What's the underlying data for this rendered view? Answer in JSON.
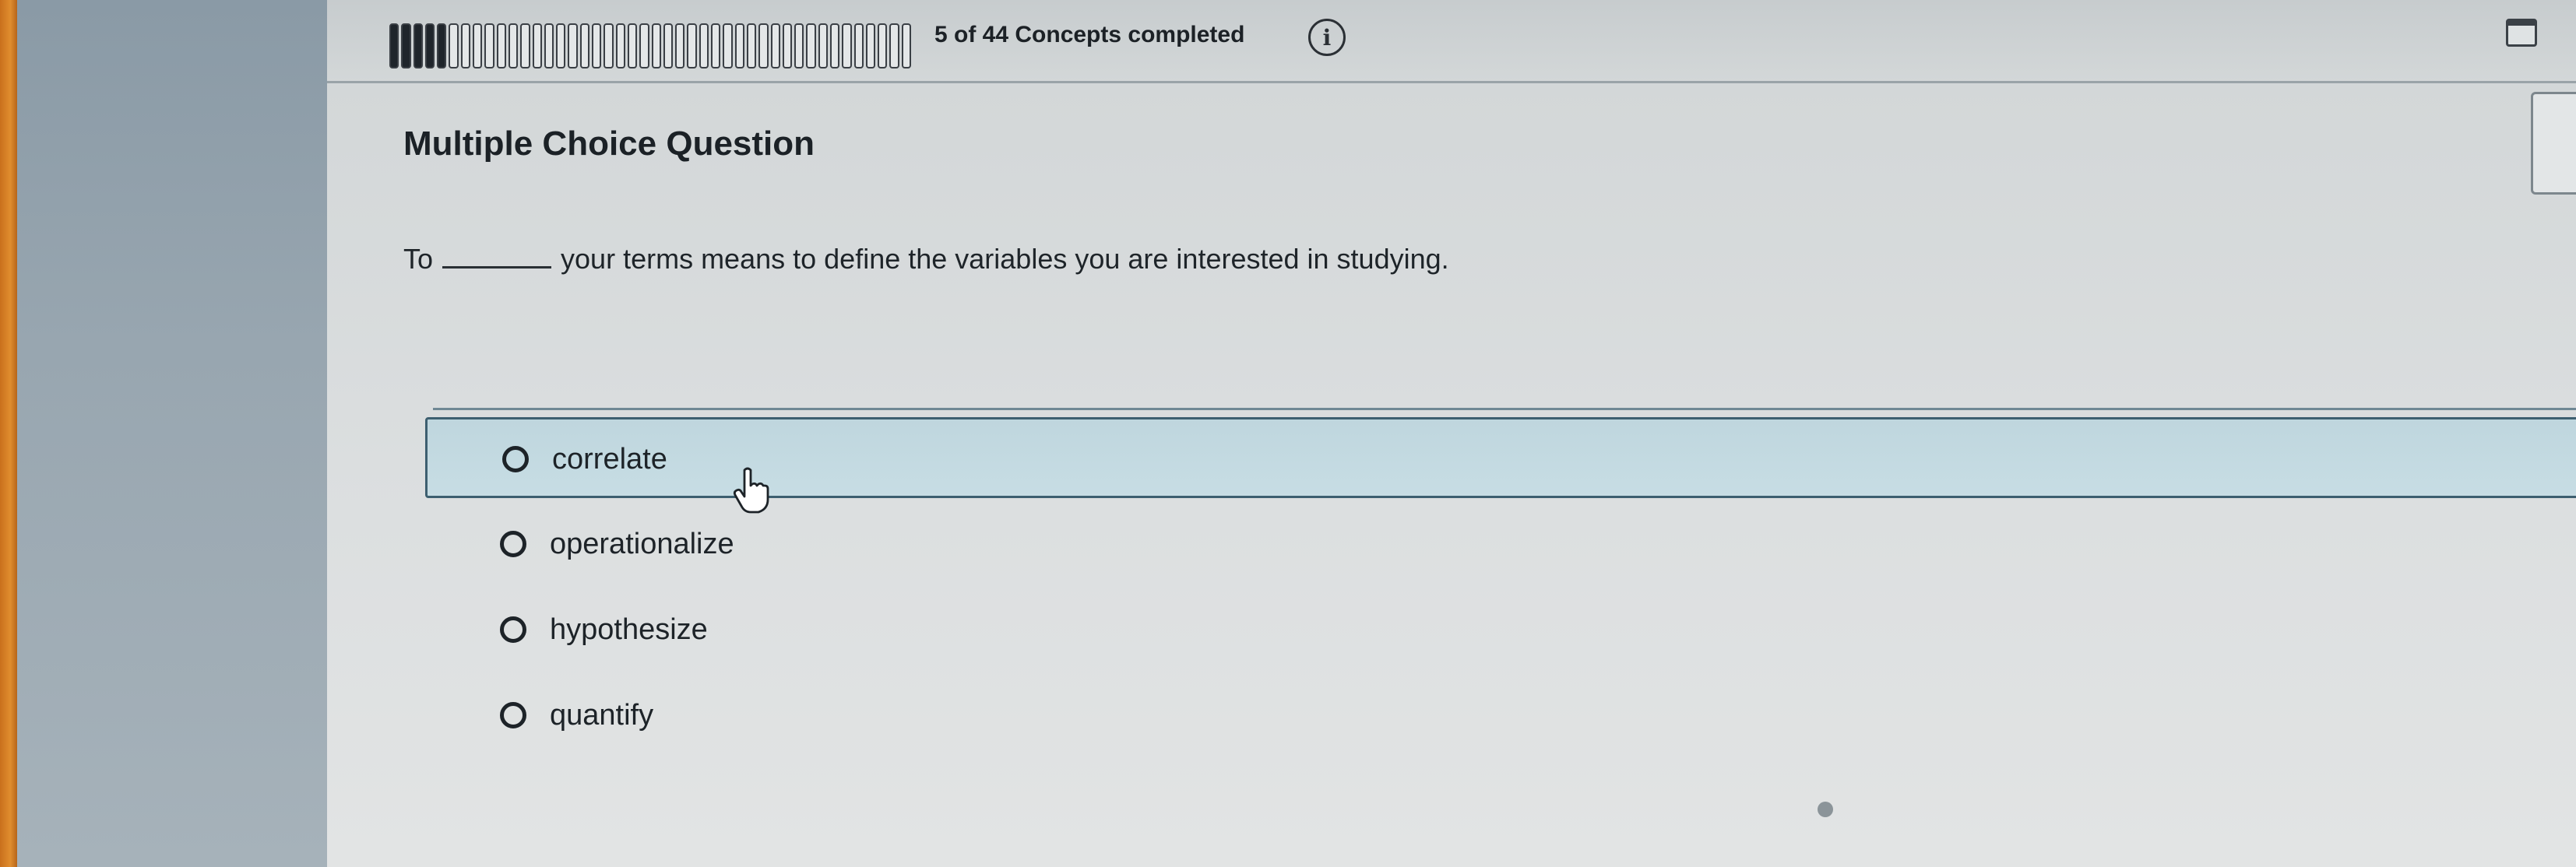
{
  "progress": {
    "text": "5 of 44 Concepts completed",
    "completed": 5,
    "total": 44
  },
  "question": {
    "type_label": "Multiple Choice Question",
    "prompt_before": "To",
    "prompt_after": "your terms means to define the variables you are interested in studying."
  },
  "options": [
    {
      "label": "correlate",
      "hovered": true
    },
    {
      "label": "operationalize",
      "hovered": false
    },
    {
      "label": "hypothesize",
      "hovered": false
    },
    {
      "label": "quantify",
      "hovered": false
    }
  ],
  "icons": {
    "info": "info-icon",
    "calendar": "calendar-icon",
    "cursor": "hand-pointer-icon"
  },
  "colors": {
    "hover_background": "#c4dae1",
    "hover_border": "#3d5f70"
  }
}
